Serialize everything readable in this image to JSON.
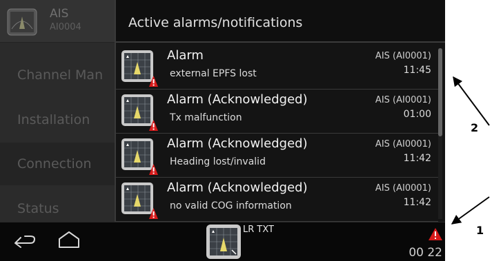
{
  "sidebar": {
    "app_title": "AIS",
    "app_subtitle": "AI0004",
    "items": [
      {
        "label": "Channel Man"
      },
      {
        "label": "Installation"
      },
      {
        "label": "Connection"
      },
      {
        "label": "Status"
      }
    ]
  },
  "panel": {
    "title": "Active alarms/notifications",
    "notifications": [
      {
        "title": "Alarm",
        "message": "external EPFS lost",
        "source": "AIS (AI0001)",
        "time": "11:45",
        "icon": "ais-alarm-icon"
      },
      {
        "title": "Alarm (Acknowledged)",
        "message": "Tx malfunction",
        "source": "AIS (AI0001)",
        "time": "01:00",
        "icon": "ais-alarm-icon"
      },
      {
        "title": "Alarm (Acknowledged)",
        "message": "Heading lost/invalid",
        "source": "AIS (AI0001)",
        "time": "11:42",
        "icon": "ais-alarm-icon"
      },
      {
        "title": "Alarm (Acknowledged)",
        "message": "no valid COG information",
        "source": "AIS (AI0001)",
        "time": "11:42",
        "icon": "ais-alarm-icon"
      }
    ]
  },
  "bottombar": {
    "app_label": "LR TXT",
    "clock": "00 22",
    "back_icon": "back-arrow-icon",
    "home_icon": "home-icon",
    "alarm_icon": "warning-triangle-icon"
  },
  "callouts": {
    "one": "1",
    "two": "2"
  },
  "colors": {
    "alarm_red": "#d71b1b",
    "background": "#141414",
    "text": "#f2f2f2"
  }
}
